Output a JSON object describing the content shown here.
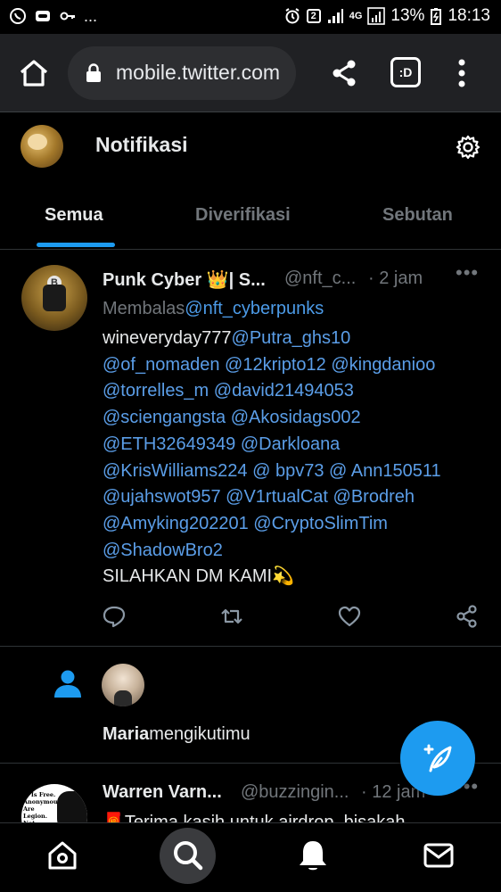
{
  "statusbar": {
    "dots": "...",
    "sim_badge": "2",
    "network": "4G",
    "battery": "13%",
    "time": "18:13"
  },
  "browser": {
    "url": "mobile.twitter.com",
    "tab_badge": ":D"
  },
  "header": {
    "title": "Notifikasi",
    "tabs": [
      {
        "label": "Semua",
        "active": true
      },
      {
        "label": "Diverifikasi",
        "active": false
      },
      {
        "label": "Sebutan",
        "active": false
      }
    ]
  },
  "tweet1": {
    "name": "Punk Cyber 👑| S...",
    "handle": "@nft_c...",
    "time": "· 2 jam",
    "more": "•••",
    "reply_prefix": "Membalas",
    "reply_to": "@nft_cyberpunks",
    "body_lines": [
      [
        {
          "t": "wineveryday777",
          "m": false
        },
        {
          "t": "@Putra_ghs10",
          "m": true
        }
      ],
      [
        {
          "t": "@of_nomaden @12kripto12 @kingdanioo",
          "m": true
        }
      ],
      [
        {
          "t": "@torrelles_m @david21494053",
          "m": true
        }
      ],
      [
        {
          "t": "@sciengangsta @Akosidags002",
          "m": true
        }
      ],
      [
        {
          "t": "@ETH32649349 @Darkloana",
          "m": true
        }
      ],
      [
        {
          "t": "@KrisWilliams224 @ bpv73 @ Ann150511",
          "m": true
        }
      ],
      [
        {
          "t": "@ujahswot957 @V1rtualCat @Brodreh",
          "m": true
        }
      ],
      [
        {
          "t": "@Amyking202201 @CryptoSlimTim",
          "m": true
        }
      ],
      [
        {
          "t": "@ShadowBro2",
          "m": true
        }
      ],
      [
        {
          "t": "SILAHKAN DM KAMI💫",
          "m": false
        }
      ]
    ],
    "avatar_coin": "B"
  },
  "follow": {
    "name": "Maria",
    "action": "mengikutimu"
  },
  "tweet2": {
    "name": "Warren Varn...",
    "handle": "@buzzingin...",
    "time": "· 12 jam",
    "more": "•••",
    "body": "🧧Terima kasih untuk airdrop, bisakah",
    "avatar_text": "ie Is Free. Anonymous. Are Legion. Not Forgive. Not Forget."
  },
  "colors": {
    "accent": "#1d9bf0",
    "mention": "#5b9ee8",
    "muted": "#71767b",
    "background": "#000000"
  },
  "icons": [
    "home-icon",
    "lock-icon",
    "share-icon",
    "tabs-icon",
    "more-vert-icon",
    "gear-icon",
    "reply-icon",
    "retweet-icon",
    "like-icon",
    "share-tweet-icon",
    "person-icon",
    "compose-icon",
    "search-icon",
    "bell-icon",
    "mail-icon"
  ]
}
